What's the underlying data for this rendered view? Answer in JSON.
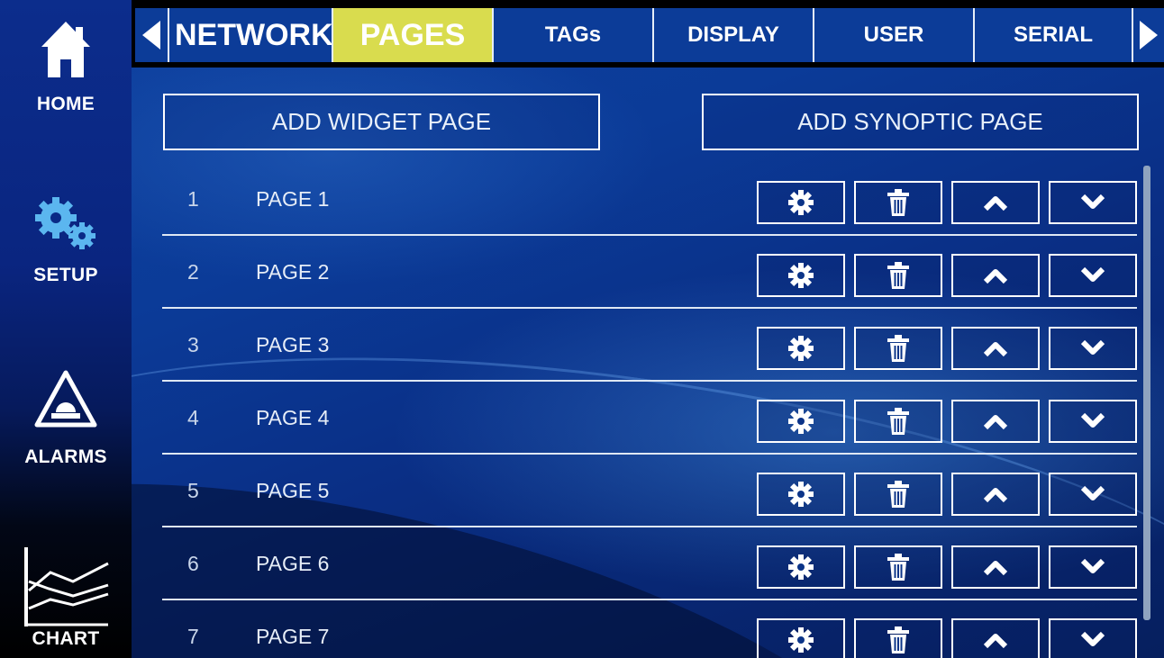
{
  "sidebar": {
    "items": [
      {
        "label": "HOME",
        "icon": "home-icon"
      },
      {
        "label": "SETUP",
        "icon": "gears-icon"
      },
      {
        "label": "ALARMS",
        "icon": "alarm-beacon-icon"
      },
      {
        "label": "CHART",
        "icon": "line-chart-icon"
      }
    ]
  },
  "tabs": {
    "items": [
      {
        "label": "NETWORK"
      },
      {
        "label": "PAGES",
        "active": true
      },
      {
        "label": "TAGs"
      },
      {
        "label": "DISPLAY"
      },
      {
        "label": "USER"
      },
      {
        "label": "SERIAL"
      }
    ],
    "prev_icon": "triangle-left-icon",
    "next_icon": "triangle-right-icon"
  },
  "actions": {
    "add_widget_page": "ADD WIDGET PAGE",
    "add_synoptic_page": "ADD SYNOPTIC PAGE"
  },
  "pages": [
    {
      "number": "1",
      "name": "PAGE 1"
    },
    {
      "number": "2",
      "name": "PAGE 2"
    },
    {
      "number": "3",
      "name": "PAGE 3"
    },
    {
      "number": "4",
      "name": "PAGE 4"
    },
    {
      "number": "5",
      "name": "PAGE 5"
    },
    {
      "number": "6",
      "name": "PAGE 6"
    },
    {
      "number": "7",
      "name": "PAGE 7"
    }
  ],
  "row_actions": [
    "gear-icon",
    "trash-icon",
    "chevron-up-icon",
    "chevron-down-icon"
  ],
  "colors": {
    "active_tab": "#d9dc4e",
    "tab_background": "#0c3c98",
    "sidebar_background": "#0a2580",
    "main_background": "#0b3b98"
  }
}
